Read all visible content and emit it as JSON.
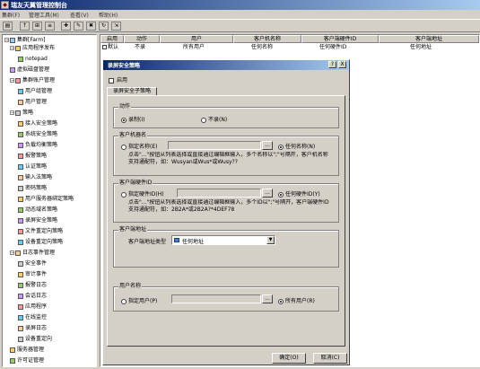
{
  "app": {
    "title": "瑞友天翼管理控制台"
  },
  "menu": [
    "集群(F)",
    "管理工具(M)",
    "查看(V)",
    "帮助(H)"
  ],
  "tree": {
    "root": "集群[Farm]",
    "items": [
      {
        "label": "应用程序发布",
        "level": 1,
        "expander": "−"
      },
      {
        "label": "notepad",
        "level": 2
      },
      {
        "label": "虚拟磁盘管理",
        "level": 1
      },
      {
        "label": "集群账户管理",
        "level": 1,
        "expander": "−"
      },
      {
        "label": "用户组管理",
        "level": 2
      },
      {
        "label": "用户管理",
        "level": 2
      },
      {
        "label": "策略",
        "level": 1,
        "expander": "−"
      },
      {
        "label": "接入安全策略",
        "level": 2
      },
      {
        "label": "系统安全策略",
        "level": 2
      },
      {
        "label": "负载均衡策略",
        "level": 2
      },
      {
        "label": "报警策略",
        "level": 2
      },
      {
        "label": "认证策略",
        "level": 2
      },
      {
        "label": "输入法策略",
        "level": 2
      },
      {
        "label": "密码策略",
        "level": 2
      },
      {
        "label": "用户服务器绑定策略",
        "level": 2
      },
      {
        "label": "动态域名策略",
        "level": 2
      },
      {
        "label": "录屏安全策略",
        "level": 2
      },
      {
        "label": "文件重定向策略",
        "level": 2
      },
      {
        "label": "设备重定向策略",
        "level": 2
      },
      {
        "label": "日志事件管理",
        "level": 1,
        "expander": "−"
      },
      {
        "label": "安全事件",
        "level": 2
      },
      {
        "label": "审计事件",
        "level": 2
      },
      {
        "label": "报警日志",
        "level": 2
      },
      {
        "label": "会话日志",
        "level": 2
      },
      {
        "label": "应用程序",
        "level": 2
      },
      {
        "label": "在线监控",
        "level": 2
      },
      {
        "label": "录屏日志",
        "level": 2
      },
      {
        "label": "设备重定向",
        "level": 2
      },
      {
        "label": "服务器管理",
        "level": 1
      },
      {
        "label": "许可证管理",
        "level": 1
      }
    ]
  },
  "list": {
    "columns": [
      "启用",
      "动作",
      "用户",
      "客户机名称",
      "客户端硬件ID",
      "客户端地址"
    ],
    "rows": [
      {
        "enabled": "默认",
        "action": "不录",
        "user": "所有用户",
        "client_name": "任何名称",
        "hardware_id": "任何硬件ID",
        "address": "任何地址"
      }
    ]
  },
  "dialog": {
    "title": "录屏安全策略",
    "title_buttons": [
      "?",
      "X"
    ],
    "enable_label": "启用",
    "tab": "录屏安全子策略",
    "action": {
      "label": "动作",
      "record": "录制(I)",
      "no_record": "不录(N)"
    },
    "client_name": {
      "label": "客户机器名",
      "specify": "指定名称(E)",
      "browse": "...",
      "any": "任何名称(N)",
      "hint": "点击\"...\"按钮从列表选择或直接通过编辑框输入，多个名称以\";\"号隔开，客户机名称支持通配符，如：Wusyan或Wus*或Wusy??"
    },
    "hardware_id": {
      "label": "客户端硬件ID",
      "specify": "指定硬件ID(H)",
      "browse": "...",
      "any": "任何硬件ID(Y)",
      "hint": "点击\"...\"按钮从列表选择或直接通过编辑框输入，多个ID以\";\"号隔开，客户端硬件ID支持通配符，如：2B2A*或2B2A?*4DEF78"
    },
    "client_address": {
      "label": "客户端地址",
      "type_label": "客户端地址类型",
      "type_value": "任何地址"
    },
    "user": {
      "label": "用户名称",
      "specify": "指定用户(P)",
      "browse": "...",
      "all": "所有用户(R)"
    },
    "ok": "确定(O)",
    "cancel": "取消(C)"
  }
}
